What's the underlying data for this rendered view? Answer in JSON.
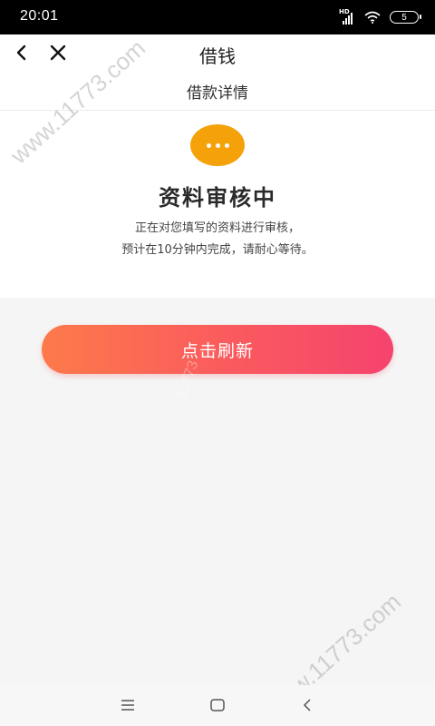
{
  "status_bar": {
    "time": "20:01",
    "signal_label": "HD",
    "battery_level": "5"
  },
  "header": {
    "title": "借钱",
    "back_icon": "chevron-left-icon",
    "close_icon": "close-icon"
  },
  "sub_header": {
    "title": "借款详情"
  },
  "status_card": {
    "icon": "more-dots-icon",
    "icon_color": "#f5a20a",
    "title": "资料审核中",
    "description_line1": "正在对您填写的资料进行审核，",
    "description_line2": "预计在10分钟内完成，请耐心等待。"
  },
  "actions": {
    "refresh_label": "点击刷新",
    "gradient_start": "#fd7a4a",
    "gradient_end": "#f5436e"
  },
  "watermark": {
    "text_main": "www.11773.com",
    "text_small": "11773"
  },
  "system_nav": {
    "menu_icon": "menu-icon",
    "home_icon": "home-icon",
    "back_icon": "back-icon"
  }
}
